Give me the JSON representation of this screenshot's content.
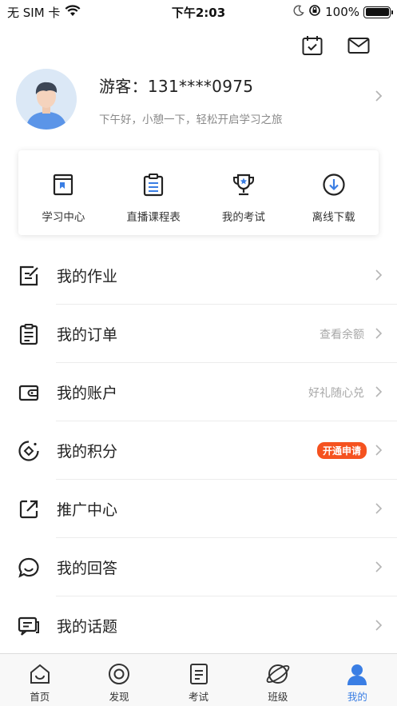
{
  "status_bar": {
    "carrier": "无 SIM 卡",
    "time": "下午2:03",
    "battery": "100%",
    "icons": [
      "wifi-icon",
      "moon-icon",
      "orientation-lock-icon",
      "battery-icon"
    ]
  },
  "header": {
    "icons": [
      "calendar-check-icon",
      "mail-icon"
    ]
  },
  "profile": {
    "name": "游客：131****0975",
    "greeting": "下午好，小憩一下，轻松开启学习之旅"
  },
  "quick_links": [
    {
      "label": "学习中心",
      "icon": "book-icon"
    },
    {
      "label": "直播课程表",
      "icon": "clipboard-icon"
    },
    {
      "label": "我的考试",
      "icon": "trophy-icon"
    },
    {
      "label": "离线下载",
      "icon": "download-icon"
    }
  ],
  "menu": [
    {
      "label": "我的作业",
      "sub": "",
      "icon": "edit-icon"
    },
    {
      "label": "我的订单",
      "sub": "查看余额",
      "icon": "clipboard-list-icon"
    },
    {
      "label": "我的账户",
      "sub": "好礼随心兑",
      "icon": "wallet-icon"
    },
    {
      "label": "我的积分",
      "badge": "开通申请",
      "icon": "points-icon"
    },
    {
      "label": "推广中心",
      "sub": "",
      "icon": "share-icon"
    },
    {
      "label": "我的回答",
      "sub": "",
      "icon": "chat-bubble-icon"
    },
    {
      "label": "我的话题",
      "sub": "",
      "icon": "topic-icon"
    }
  ],
  "tabs": [
    {
      "label": "首页",
      "icon": "home-icon"
    },
    {
      "label": "发现",
      "icon": "discover-icon"
    },
    {
      "label": "考试",
      "icon": "exam-icon"
    },
    {
      "label": "班级",
      "icon": "class-icon"
    },
    {
      "label": "我的",
      "icon": "person-icon",
      "active": true
    }
  ],
  "colors": {
    "accent": "#3a7ee4",
    "badge": "#f5521f",
    "text": "#222222",
    "muted": "#a8a8a8"
  }
}
